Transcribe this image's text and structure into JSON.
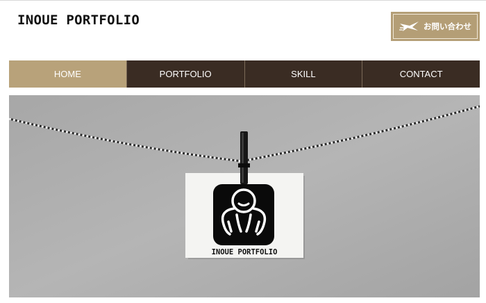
{
  "header": {
    "site_title": "INOUE PORTFOLIO",
    "contact_button_label": "お問い合わせ",
    "contact_icon": "paper-plane-icon"
  },
  "nav": {
    "items": [
      {
        "label": "HOME",
        "active": true
      },
      {
        "label": "PORTFOLIO",
        "active": false
      },
      {
        "label": "SKILL",
        "active": false
      },
      {
        "label": "CONTACT",
        "active": false
      }
    ]
  },
  "hero": {
    "card_logo_text": "INOUE PORTFOLIO",
    "logo_icon": "figure-logo-icon",
    "clip_icon": "clothespin-icon"
  },
  "colors": {
    "brand_tan": "#b8a27a",
    "nav_dark": "#3a2c23",
    "button_tan": "#b49e76"
  }
}
